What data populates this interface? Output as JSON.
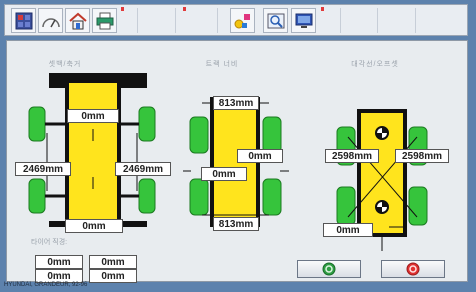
{
  "toolbar": {
    "items": [
      "grid-icon",
      "gauge-icon",
      "home-icon",
      "printer-icon",
      "shapes-icon",
      "preview-icon",
      "monitor-icon"
    ]
  },
  "sections": {
    "left_title": "셋백/축거",
    "middle_title": "트랙 너비",
    "right_title": "대각선/오프셋",
    "tire_label": "타이어 직경:"
  },
  "left": {
    "top_value": "0mm",
    "left_value": "2469mm",
    "right_value": "2469mm",
    "bottom_value": "0mm"
  },
  "middle": {
    "top_width": "813mm",
    "right_value": "0mm",
    "left_value": "0mm",
    "bottom_width": "813mm"
  },
  "right": {
    "left_diag": "2598mm",
    "right_diag": "2598mm",
    "offset_value": "0mm"
  },
  "tire": {
    "values": [
      "0mm",
      "0mm",
      "0mm",
      "0mm"
    ]
  },
  "buttons": {
    "ok": "ok-icon",
    "cancel": "cancel-icon"
  },
  "status": {
    "vehicle": "HYUNDAI, GRANDEUR, 92-96"
  },
  "colors": {
    "wheel": "#36c43c",
    "body": "#ffe41d",
    "frame": "#111111"
  }
}
